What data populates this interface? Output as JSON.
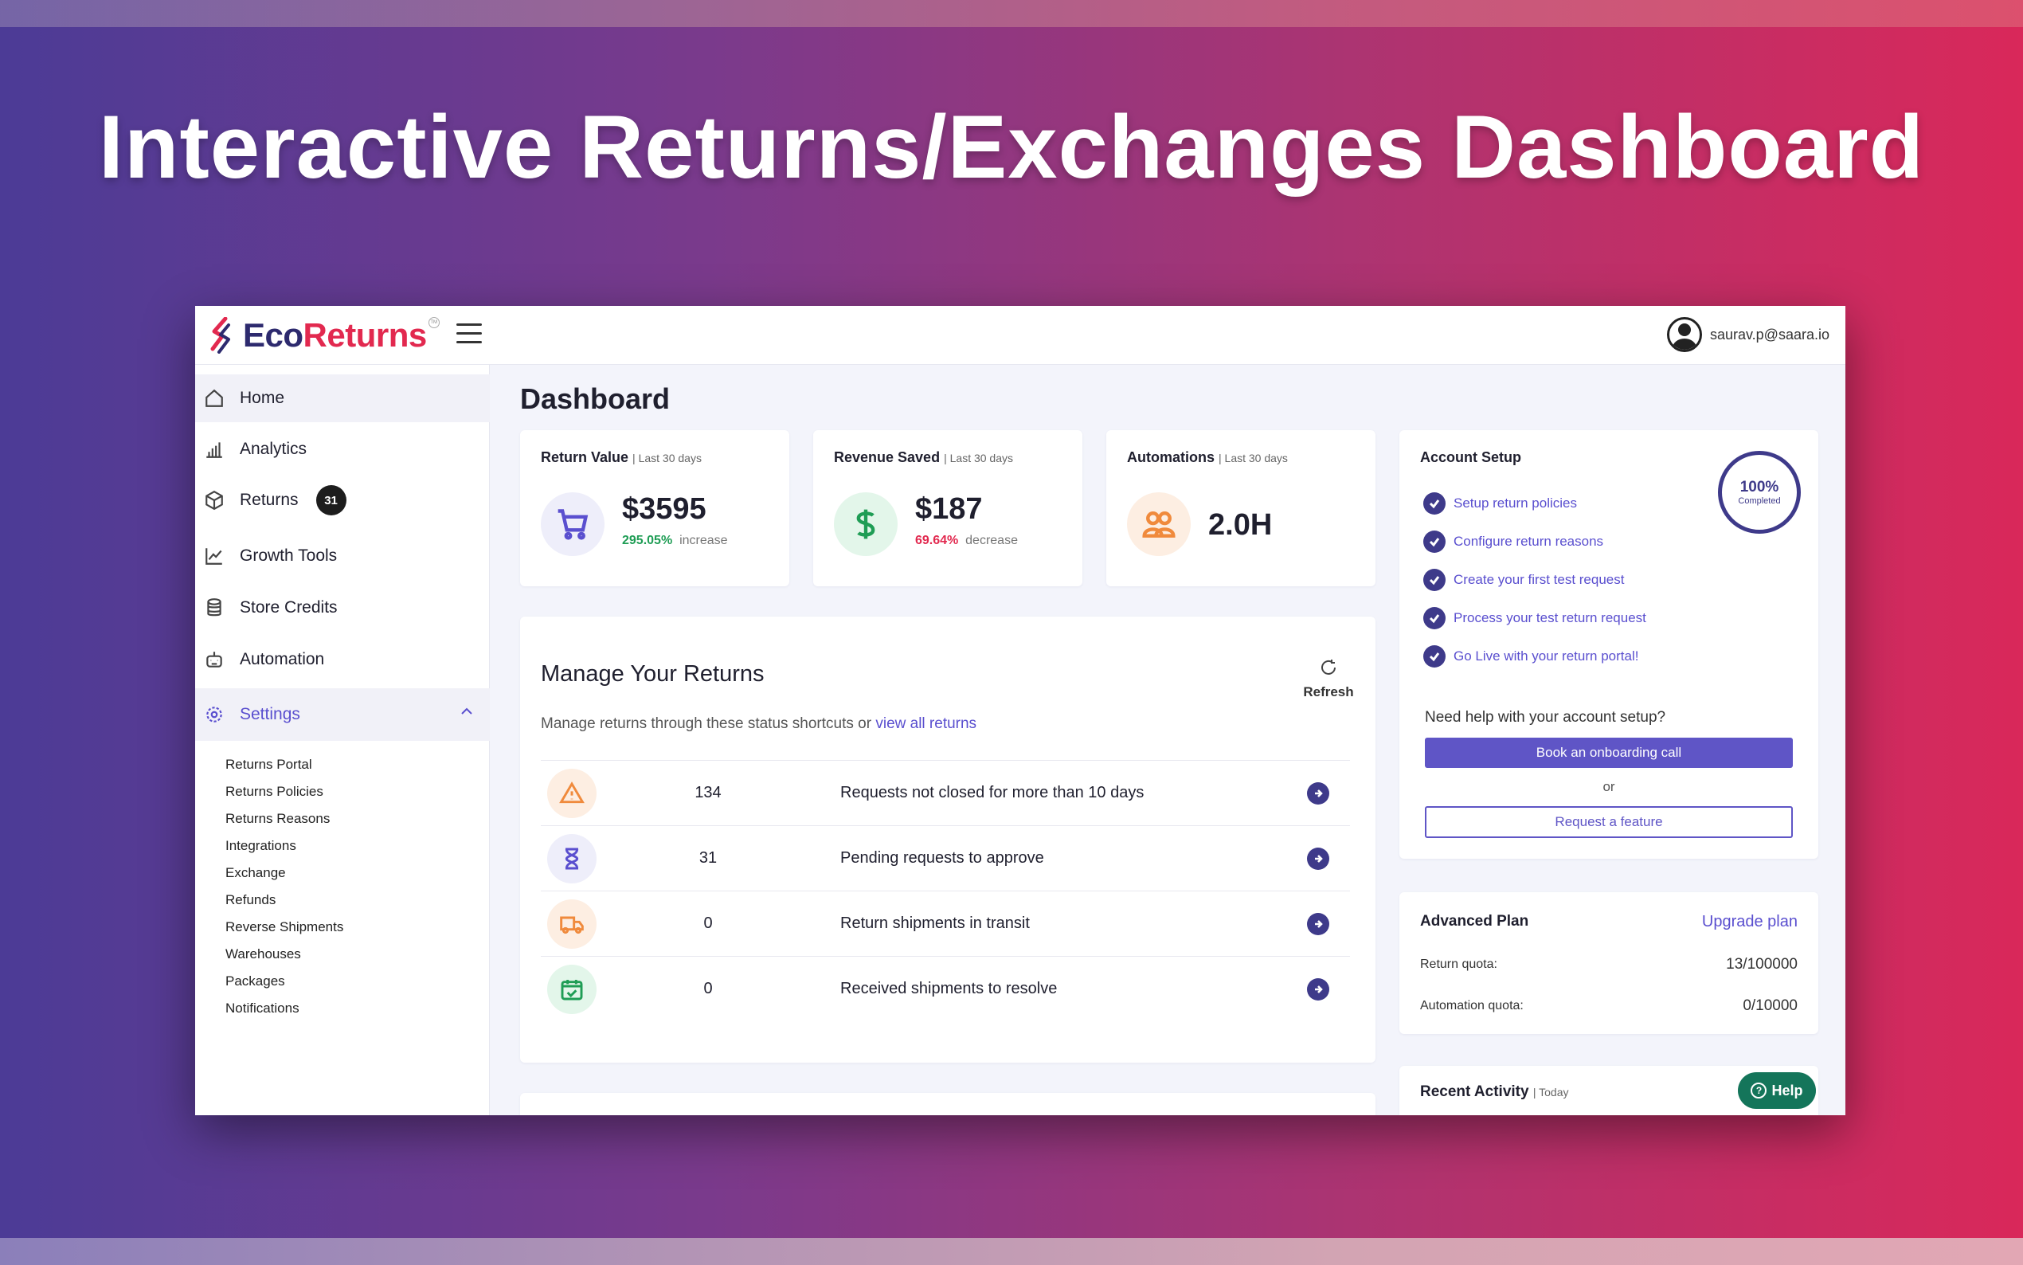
{
  "hero": {
    "title": "Interactive Returns/Exchanges Dashboard"
  },
  "header": {
    "logo_eco": "Eco",
    "logo_returns": "Returns",
    "logo_tm": "TM",
    "user_email": "saurav.p@saara.io"
  },
  "sidebar": {
    "items": [
      {
        "label": "Home",
        "icon": "home-icon"
      },
      {
        "label": "Analytics",
        "icon": "bar-chart-icon"
      },
      {
        "label": "Returns",
        "icon": "box-icon",
        "badge": "31"
      },
      {
        "label": "Growth Tools",
        "icon": "trend-icon"
      },
      {
        "label": "Store Credits",
        "icon": "coins-icon"
      },
      {
        "label": "Automation",
        "icon": "robot-icon"
      }
    ],
    "settings": {
      "label": "Settings",
      "icon": "gear-icon",
      "expanded": true
    },
    "sub_items": [
      "Returns Portal",
      "Returns Policies",
      "Returns Reasons",
      "Integrations",
      "Exchange",
      "Refunds",
      "Reverse Shipments",
      "Warehouses",
      "Packages",
      "Notifications"
    ]
  },
  "main": {
    "title": "Dashboard",
    "stats": [
      {
        "title": "Return Value",
        "period": "| Last 30 days",
        "value": "$3595",
        "change": "295.05%",
        "change_word": "increase",
        "direction": "up",
        "icon": "cart-icon",
        "color": "#5a4fcf",
        "bg": "#eeeefa"
      },
      {
        "title": "Revenue Saved",
        "period": "| Last 30 days",
        "value": "$187",
        "change": "69.64%",
        "change_word": "decrease",
        "direction": "down",
        "icon": "dollar-icon",
        "color": "#1f9d55",
        "bg": "#e3f6ea"
      },
      {
        "title": "Automations",
        "period": "| Last 30 days",
        "value": "2.0H",
        "icon": "users-icon",
        "color": "#f08a3c",
        "bg": "#fdeee2"
      }
    ],
    "manage_returns": {
      "title": "Manage Your Returns",
      "refresh_label": "Refresh",
      "description": "Manage returns through these status shortcuts or ",
      "link": "view all returns",
      "rows": [
        {
          "count": "134",
          "label": "Requests not closed for more than 10 days",
          "icon": "warning-icon",
          "color": "#f08a3c",
          "bg": "#fdeee2"
        },
        {
          "count": "31",
          "label": "Pending requests to approve",
          "icon": "hourglass-icon",
          "color": "#5a4fcf",
          "bg": "#eeeefa"
        },
        {
          "count": "0",
          "label": "Return shipments in transit",
          "icon": "truck-icon",
          "color": "#f08a3c",
          "bg": "#fdeee2"
        },
        {
          "count": "0",
          "label": "Received shipments to resolve",
          "icon": "calendar-check-icon",
          "color": "#1f9d55",
          "bg": "#e3f6ea"
        }
      ]
    }
  },
  "account_setup": {
    "title": "Account Setup",
    "progress": "100%",
    "progress_label": "Completed",
    "progress_value": 1.0,
    "steps": [
      "Setup return policies",
      "Configure return reasons",
      "Create your first test request",
      "Process your test return request",
      "Go Live with your return portal!"
    ],
    "help_question": "Need help with your account setup?",
    "book_call": "Book an onboarding call",
    "or": "or",
    "request_feature": "Request a feature"
  },
  "plan": {
    "title": "Advanced Plan",
    "upgrade": "Upgrade plan",
    "return_quota_label": "Return quota:",
    "return_quota_value": "13/100000",
    "automation_quota_label": "Automation quota:",
    "automation_quota_value": "0/10000"
  },
  "recent_activity": {
    "title": "Recent Activity",
    "period": "| Today"
  },
  "help": {
    "label": "Help",
    "q": "?"
  },
  "colors": {
    "accent": "#5a4fcf",
    "brand_navy": "#2d2a6e",
    "brand_red": "#e2294f",
    "help_green": "#14755a"
  }
}
